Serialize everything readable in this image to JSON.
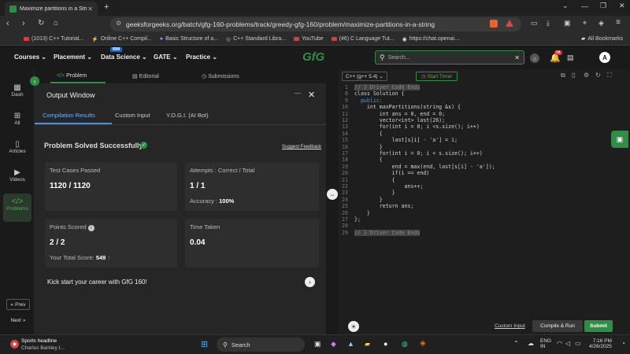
{
  "browser": {
    "tab_title": "Maximize partitions in a String",
    "url": "geeksforgeeks.org/batch/gfg-160-problems/track/greedy-gfg-160/problem/maximize-partitions-in-a-string",
    "bookmarks": [
      "(1013) C++ Tutorial...",
      "Online C++ Compil...",
      "Basic Structure of a...",
      "C++ Standard Libra...",
      "YouTube",
      "(46) C Language Tut...",
      "https://chat.openai...."
    ],
    "all_bookmarks": "All Bookmarks"
  },
  "site_nav": {
    "items": [
      "Courses",
      "Placement",
      "Data Science",
      "GATE",
      "Practice"
    ],
    "ibm_badge": "IBM",
    "logo": "GfG",
    "search_placeholder": "Search...",
    "notif_count": "34",
    "avatar": "A"
  },
  "sidebar": {
    "items": [
      "Dash",
      "All",
      "Articles",
      "Videos",
      "Problems"
    ],
    "prev": "Prev",
    "next": "Next"
  },
  "left_tabs": [
    "Problem",
    "Editorial",
    "Submissions"
  ],
  "output": {
    "title": "Output Window",
    "tabs": [
      "Compilation Results",
      "Custom Input",
      "Y.O.G.I. (AI Bot)"
    ],
    "status": "Problem Solved Successfully",
    "suggest": "Suggest Feedback",
    "test_cases_label": "Test Cases Passed",
    "test_cases_value": "1120 / 1120",
    "attempts_label": "Attempts : Correct / Total",
    "attempts_value": "1 / 1",
    "accuracy_label": "Accuracy :",
    "accuracy_value": "100%",
    "points_label": "Points Scored",
    "points_value": "2 / 2",
    "total_score_label": "Your Total Score:",
    "total_score_value": "549",
    "time_label": "Time Taken",
    "time_value": "0.04",
    "kick_start": "Kick start your career with GfG 160!"
  },
  "editor": {
    "language": "C++ (g++ 5.4)",
    "timer": "Start Timer",
    "custom_input": "Custom Input",
    "compile_run": "Compile & Run",
    "submit": "Submit",
    "line_numbers": [
      "1",
      "8",
      "9",
      "10",
      "11",
      "12",
      "13",
      "14",
      "15",
      "16",
      "17",
      "18",
      "19",
      "20",
      "21",
      "22",
      "23",
      "24",
      "25",
      "26",
      "27",
      "28",
      "29"
    ],
    "code_lines": [
      "// } Driver Code Ends",
      "class Solution {",
      "  public:",
      "    int maxPartitions(string &s) {",
      "        int ans = 0, end = 0;",
      "        vector<int> last(26);",
      "        for(int i = 0; i <s.size(); i++)",
      "        {",
      "            last[s[i] - 'a'] = i;",
      "        }",
      "        for(int i = 0; i < s.size(); i++)",
      "        {",
      "            end = max(end, last[s[i] - 'a']);",
      "            if(i == end)",
      "            {",
      "                ans++;",
      "            }",
      "        }",
      "        return ans;",
      "    }",
      "};",
      "",
      "// } Driver Code Ends"
    ]
  },
  "taskbar": {
    "news_title": "Sports headline",
    "news_sub": "Charles Barkley I...",
    "search": "Search",
    "lang1": "ENG",
    "lang2": "IN",
    "time": "7:16 PM",
    "date": "4/26/2025"
  }
}
